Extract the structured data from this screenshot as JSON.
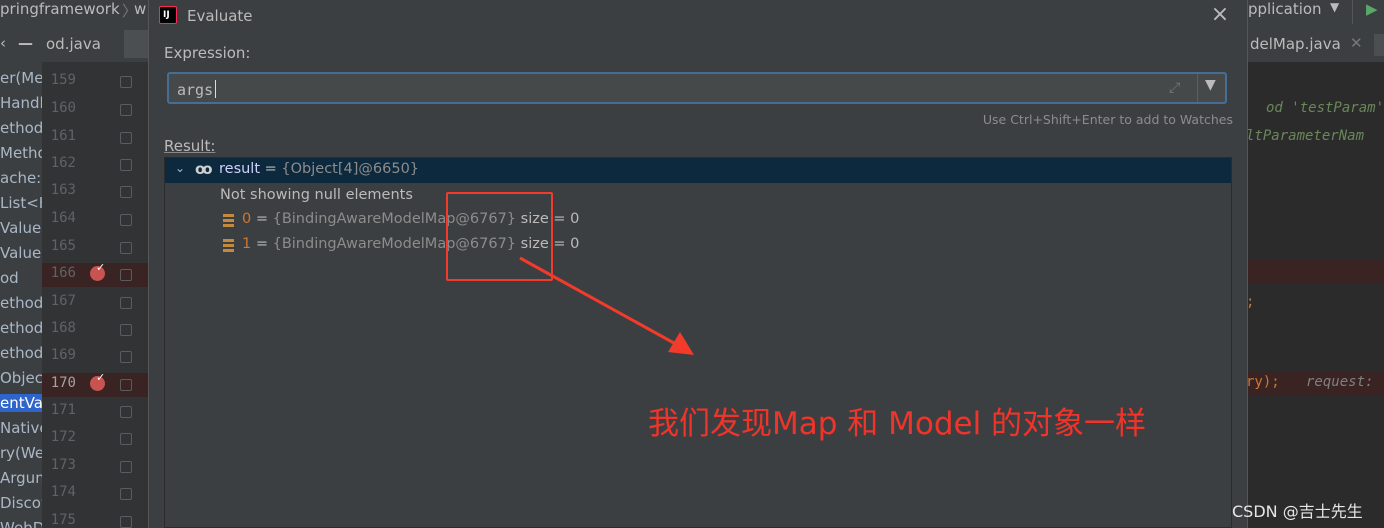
{
  "ide": {
    "project_crumb": "pringframework",
    "crumb_next": "w",
    "run_config": "pplication",
    "left_tab": "od.java",
    "right_tab": "delMap.java",
    "line_numbers": [
      "159",
      "160",
      "161",
      "162",
      "163",
      "164",
      "165",
      "166",
      "167",
      "168",
      "169",
      "170",
      "171",
      "172",
      "173",
      "174",
      "175"
    ],
    "structure_fragments": [
      "er(Me",
      "Handl",
      "ethod",
      "Metho",
      "ache:N",
      "List<H",
      "ValueH",
      "ValueH",
      "od",
      "ethod",
      "ethod",
      "ethod",
      "Objec",
      "entValu",
      "Native\\",
      "ry(Wel",
      "Argum",
      "Discov",
      "WebDa"
    ],
    "code_fragments": [
      "od 'testParam'",
      "ltParameterNam",
      ";",
      "ry);",
      "request:"
    ]
  },
  "dialog": {
    "title": "Evaluate",
    "app_icon_text": "IJ",
    "expression_label": "Expression:",
    "expression_value": "args",
    "hint": "Use Ctrl+Shift+Enter to add to Watches",
    "result_label": "Result:",
    "result": {
      "name": "result",
      "equals": " = ",
      "value": "{Object[4]@6650}",
      "note": "Not showing null elements",
      "children": [
        {
          "index": "0",
          "equals": " = ",
          "value": "{BindingAwareModelMap@6767}",
          "size_key": "size",
          "size_eq": " = ",
          "size_val": "0"
        },
        {
          "index": "1",
          "equals": " = ",
          "value": "{BindingAwareModelMap@6767}",
          "size_key": "size",
          "size_eq": " = ",
          "size_val": "0"
        }
      ]
    }
  },
  "annotation": {
    "text": "我们发现Map 和 Model 的对象一样",
    "color": "#f0342a"
  },
  "watermark": "CSDN @吉士先生",
  "icons": {
    "close": "close-icon",
    "dropdown": "chevron-down-icon",
    "expand": "expand-icon",
    "watch": "watch-glasses-icon",
    "element": "array-element-icon",
    "breakpoint": "breakpoint-icon"
  }
}
